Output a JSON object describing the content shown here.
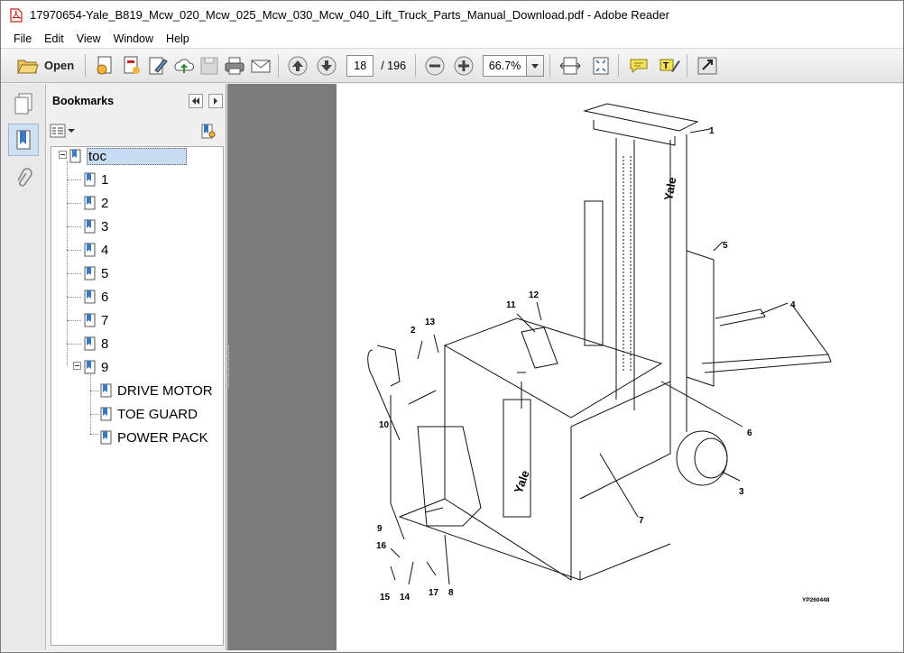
{
  "window": {
    "title": "17970654-Yale_B819_Mcw_020_Mcw_025_Mcw_030_Mcw_040_Lift_Truck_Parts_Manual_Download.pdf - Adobe Reader"
  },
  "menu": [
    "File",
    "Edit",
    "View",
    "Window",
    "Help"
  ],
  "toolbar": {
    "open_label": "Open",
    "page_current": "18",
    "page_total": "/ 196",
    "zoom": "66.7%"
  },
  "bookmarks": {
    "title": "Bookmarks",
    "items": [
      {
        "label": "toc",
        "selected": true
      },
      {
        "label": "1"
      },
      {
        "label": "2"
      },
      {
        "label": "3"
      },
      {
        "label": "4"
      },
      {
        "label": "5"
      },
      {
        "label": "6"
      },
      {
        "label": "7"
      },
      {
        "label": "8"
      },
      {
        "label": "9"
      },
      {
        "label": "DRIVE MOTOR"
      },
      {
        "label": "TOE GUARD"
      },
      {
        "label": "POWER PACK"
      }
    ]
  },
  "document": {
    "callouts": [
      "1",
      "2",
      "3",
      "4",
      "5",
      "6",
      "7",
      "8",
      "9",
      "10",
      "11",
      "12",
      "13",
      "14",
      "15",
      "16",
      "17"
    ],
    "brand_text": "Yale",
    "figure_code": "YP260448"
  },
  "colors": {
    "pdf_red": "#c8211b",
    "selection": "#c6dcf2",
    "doc_background": "#7a7a7a"
  }
}
